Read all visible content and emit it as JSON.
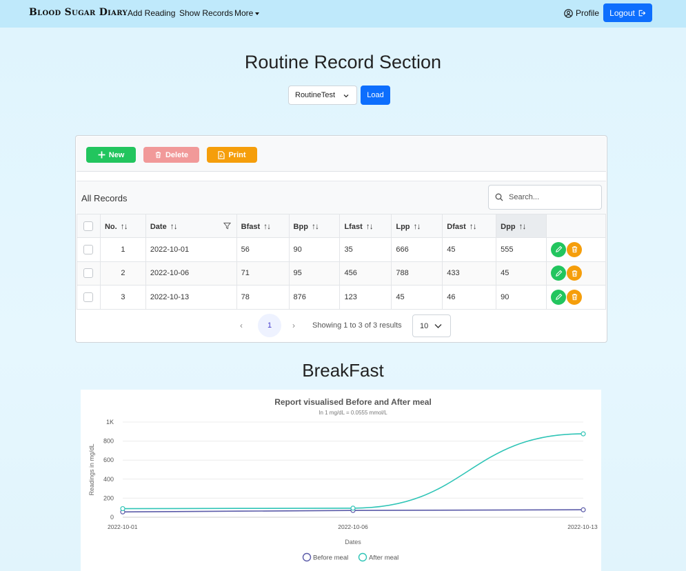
{
  "nav": {
    "brand": "Blood Sugar Diary",
    "add_reading": "Add Reading",
    "show_records": "Show Records",
    "more": "More",
    "profile": "Profile",
    "logout": "Logout"
  },
  "page": {
    "title": "Routine Record Section",
    "select_value": "RoutineTest",
    "load_label": "Load"
  },
  "toolbar": {
    "new": "New",
    "delete": "Delete",
    "print": "Print"
  },
  "table": {
    "heading": "All Records",
    "search_placeholder": "Search...",
    "columns": [
      "No.",
      "Date",
      "Bfast",
      "Bpp",
      "Lfast",
      "Lpp",
      "Dfast",
      "Dpp"
    ],
    "rows": [
      [
        "1",
        "2022-10-01",
        "56",
        "90",
        "35",
        "666",
        "45",
        "555"
      ],
      [
        "2",
        "2022-10-06",
        "71",
        "95",
        "456",
        "788",
        "433",
        "45"
      ],
      [
        "3",
        "2022-10-13",
        "78",
        "876",
        "123",
        "45",
        "46",
        "90"
      ]
    ]
  },
  "pager": {
    "page": "1",
    "info": "Showing 1 to 3 of 3 results",
    "page_size": "10",
    "prev": "‹",
    "next": "›"
  },
  "section_heading": "BreakFast",
  "chart_data": {
    "type": "line",
    "title": "Report visualised Before and After meal",
    "subtitle": "In 1 mg/dL = 0.0555 mmol/L",
    "xlabel": "Dates",
    "ylabel": "Readings in mg/dL",
    "x": [
      "2022-10-01",
      "2022-10-06",
      "2022-10-13"
    ],
    "yticks": [
      "0",
      "200",
      "400",
      "600",
      "800",
      "1K"
    ],
    "ylim": [
      0,
      1000
    ],
    "grid": true,
    "legend_position": "bottom",
    "series": [
      {
        "name": "Before meal",
        "values": [
          56,
          71,
          78
        ],
        "color": "#5a5aa8"
      },
      {
        "name": "After meal",
        "values": [
          90,
          95,
          876
        ],
        "color": "#2ec4b6"
      }
    ]
  }
}
